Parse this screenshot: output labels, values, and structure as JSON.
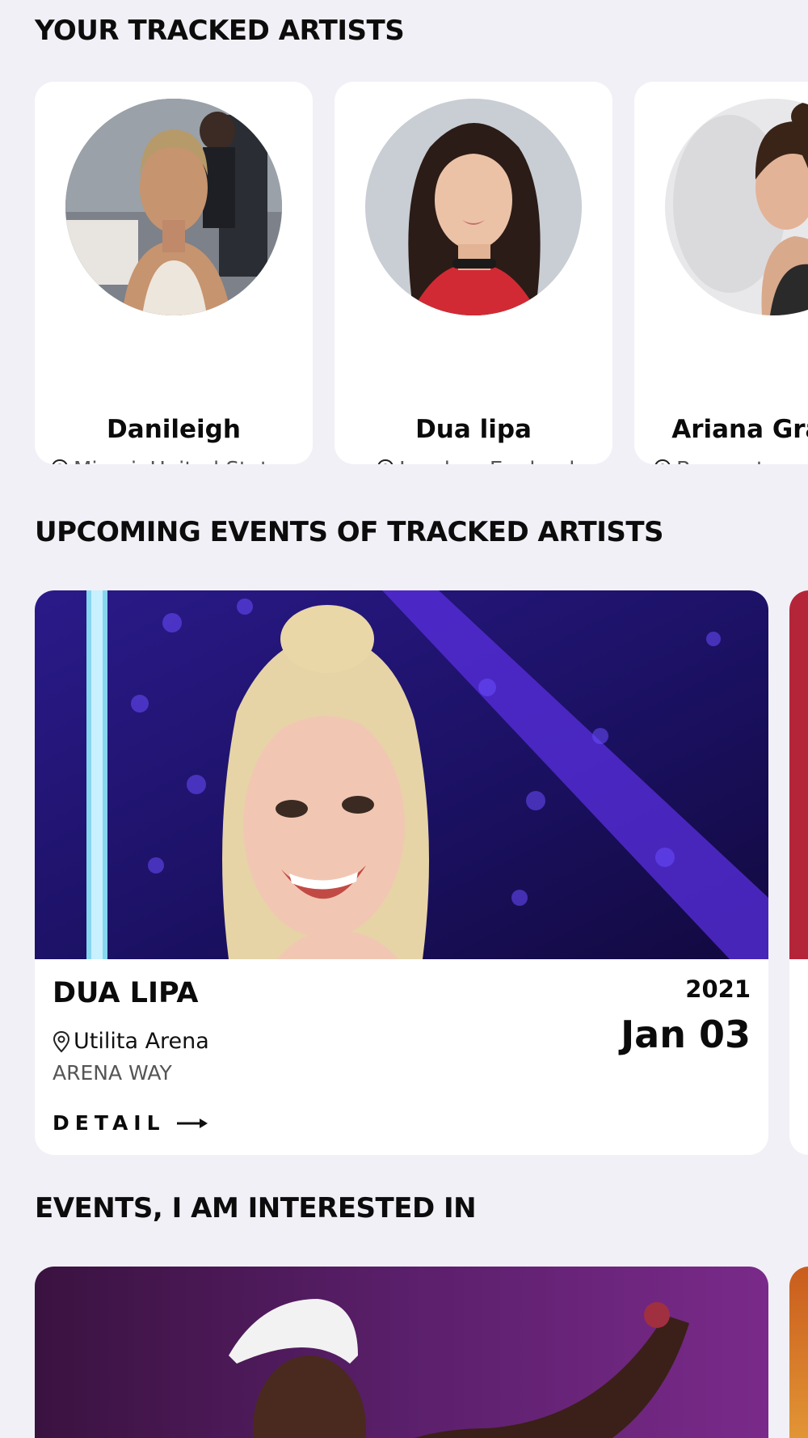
{
  "sections": {
    "tracked_title": "YOUR TRACKED ARTISTS",
    "upcoming_title": "UPCOMING EVENTS OF TRACKED ARTISTS",
    "interested_title": "EVENTS, I AM INTERESTED IN"
  },
  "artists": [
    {
      "name": "Danileigh",
      "location": "Miami,  United States"
    },
    {
      "name": "Dua lipa",
      "location": "London, England"
    },
    {
      "name": "Ariana Grande",
      "location": "Boca raton, A"
    }
  ],
  "event": {
    "artist": "DUA LIPA",
    "venue": "Utilita Arena",
    "street": "ARENA WAY",
    "year": "2021",
    "date": "Jan 03",
    "detail_label": "DETAIL"
  },
  "icons": {
    "location": "location-pin-icon",
    "arrow": "arrow-right-icon"
  },
  "colors": {
    "background": "#f1f0f6",
    "card": "#ffffff",
    "text": "#0b0b0b",
    "muted": "#555555"
  }
}
